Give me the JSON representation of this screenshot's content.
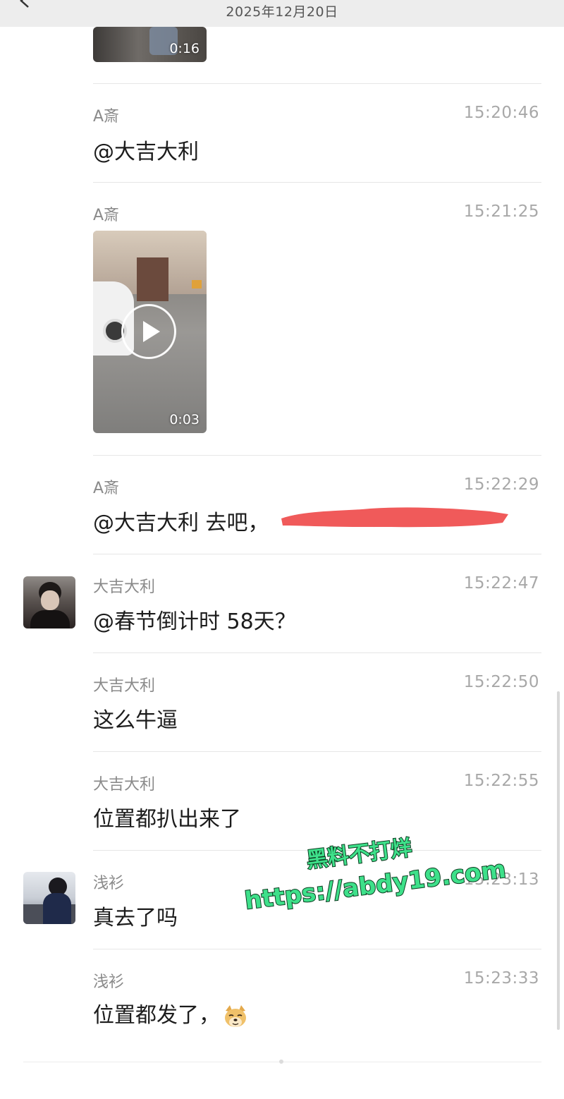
{
  "header": {
    "date": "2025年12月20日",
    "back_icon": "chevron-left-icon"
  },
  "messages": [
    {
      "sender": "",
      "time": "",
      "video_duration": "0:16"
    },
    {
      "sender": "A斎",
      "time": "15:20:46",
      "text": "@大吉大利"
    },
    {
      "sender": "A斎",
      "time": "15:21:25",
      "video_duration": "0:03"
    },
    {
      "sender": "A斎",
      "time": "15:22:29",
      "text": "@大吉大利 去吧，"
    },
    {
      "sender": "大吉大利",
      "time": "15:22:47",
      "text": "@春节倒计时 58天？"
    },
    {
      "sender": "大吉大利",
      "time": "15:22:50",
      "text": "这么牛逼"
    },
    {
      "sender": "大吉大利",
      "time": "15:22:55",
      "text": "位置都扒出来了"
    },
    {
      "sender": "浅衫",
      "time": "15:23:13",
      "text": "真去了吗"
    },
    {
      "sender": "浅衫",
      "time": "15:23:33",
      "text": "位置都发了，"
    }
  ],
  "watermark": {
    "line1": "黑料不打烊",
    "line2": "https://abdy19.com"
  },
  "colors": {
    "redaction": "#f05a5a",
    "watermark_fill": "#3ee08a"
  }
}
